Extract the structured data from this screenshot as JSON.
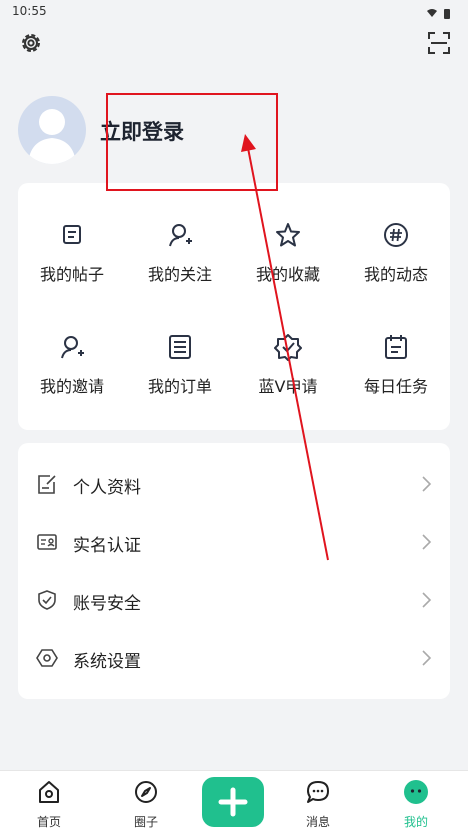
{
  "status_bar": {
    "time": "10:55"
  },
  "header": {
    "settings_icon": "gear-icon",
    "scan_icon": "scan-icon"
  },
  "profile": {
    "login_label": "立即登录"
  },
  "grid": {
    "items": [
      {
        "label": "我的帖子",
        "icon": "post-icon"
      },
      {
        "label": "我的关注",
        "icon": "follow-icon"
      },
      {
        "label": "我的收藏",
        "icon": "star-icon"
      },
      {
        "label": "我的动态",
        "icon": "hashtag-icon"
      },
      {
        "label": "我的邀请",
        "icon": "invite-icon"
      },
      {
        "label": "我的订单",
        "icon": "order-icon"
      },
      {
        "label": "蓝V申请",
        "icon": "verify-badge-icon"
      },
      {
        "label": "每日任务",
        "icon": "calendar-icon"
      }
    ]
  },
  "menu": {
    "items": [
      {
        "label": "个人资料",
        "icon": "edit-doc-icon"
      },
      {
        "label": "实名认证",
        "icon": "id-card-icon"
      },
      {
        "label": "账号安全",
        "icon": "shield-icon"
      },
      {
        "label": "系统设置",
        "icon": "hexagon-settings-icon"
      }
    ]
  },
  "tabbar": {
    "tabs": [
      {
        "label": "首页",
        "icon": "home-icon"
      },
      {
        "label": "圈子",
        "icon": "compass-icon"
      },
      {
        "label": "消息",
        "icon": "chat-icon"
      },
      {
        "label": "我的",
        "icon": "me-icon",
        "active": true
      }
    ]
  },
  "colors": {
    "accent": "#20c08e",
    "annotation": "#e0141e",
    "background": "#f2f3f5"
  }
}
